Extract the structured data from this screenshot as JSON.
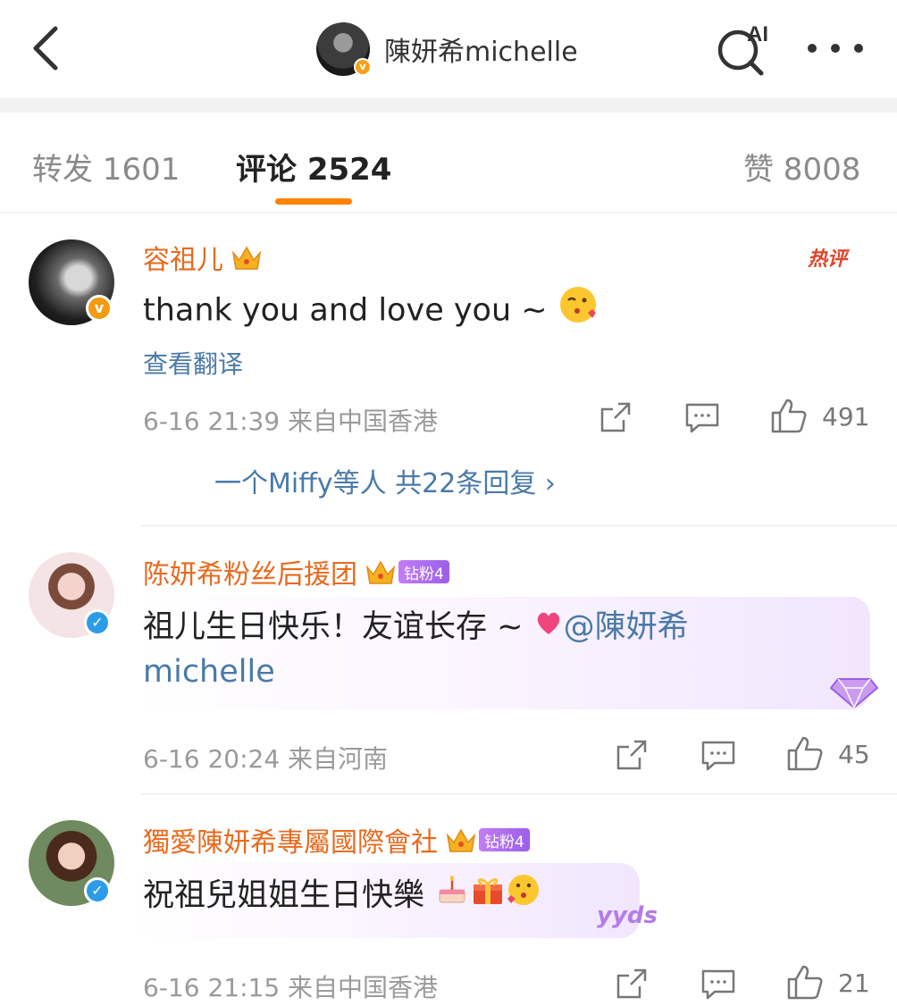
{
  "header": {
    "account_name": "陳妍希michelle",
    "ai_label": "AI"
  },
  "tabs": {
    "repost": "转发 1601",
    "comments": "评论 2524",
    "likes": "赞 8008"
  },
  "comments": [
    {
      "username": "容祖儿",
      "text": "thank you and love you ~",
      "hot_tag": "热评",
      "translate": "查看翻译",
      "meta": "6-16 21:39 来自中国香港",
      "likes": "491",
      "replies": "一个Miffy等人  共22条回复 ›"
    },
    {
      "username": "陈妍希粉丝后援团",
      "fan_badge": "钻粉4",
      "text_line1": "祖儿生日快乐！友谊长存 ~",
      "mention_line1": "@陳妍希",
      "mention_line2": "michelle",
      "meta": "6-16 20:24 来自河南",
      "likes": "45"
    },
    {
      "username": "獨愛陳妍希專屬國際會社",
      "fan_badge": "钻粉4",
      "text": "祝祖兒姐姐生日快樂",
      "sticker": "yyds",
      "meta": "6-16 21:15 来自中国香港",
      "likes": "21"
    }
  ],
  "colors": {
    "accent": "#ff8200",
    "username": "#e86a1e",
    "link": "#4a7aa8",
    "verified_orange": "#f39b12",
    "verified_blue": "#2d9ce8"
  },
  "icons": [
    "back-arrow-icon",
    "ai-search-icon",
    "more-icon",
    "crown-icon",
    "share-icon",
    "comment-icon",
    "like-icon",
    "verified-icon"
  ]
}
